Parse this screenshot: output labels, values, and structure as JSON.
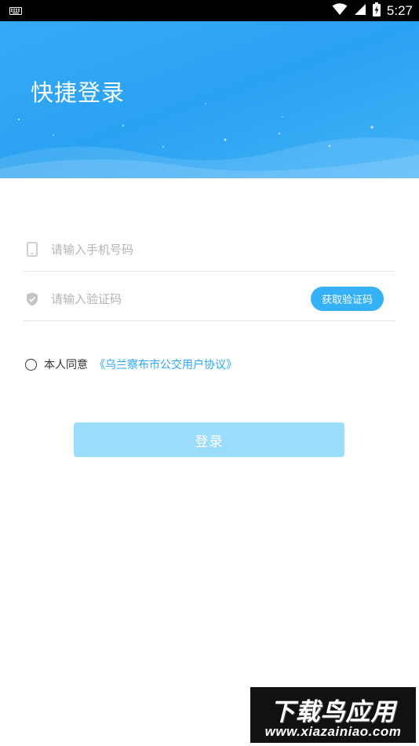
{
  "status_bar": {
    "time": "5:27",
    "battery_glyph": "⚡",
    "icons": [
      "keyboard-icon",
      "wifi-icon",
      "signal-icon",
      "battery-charging-icon"
    ]
  },
  "header": {
    "title": "快捷登录"
  },
  "form": {
    "phone": {
      "placeholder": "请输入手机号码",
      "value": "",
      "icon": "phone-icon"
    },
    "code": {
      "placeholder": "请输入验证码",
      "value": "",
      "icon": "shield-icon"
    },
    "get_code_label": "获取验证码"
  },
  "agreement": {
    "checked": false,
    "text": "本人同意",
    "link": "《乌兰察布市公交用户协议》"
  },
  "login_button": {
    "label": "登录"
  },
  "watermark": {
    "title": "下载鸟应用",
    "url": "www.xiazainiao.com"
  },
  "colors": {
    "header_blue": "#2ea5f3",
    "accent": "#35b1f6",
    "link": "#2aa7f0",
    "login_disabled": "#9cdcfb"
  }
}
